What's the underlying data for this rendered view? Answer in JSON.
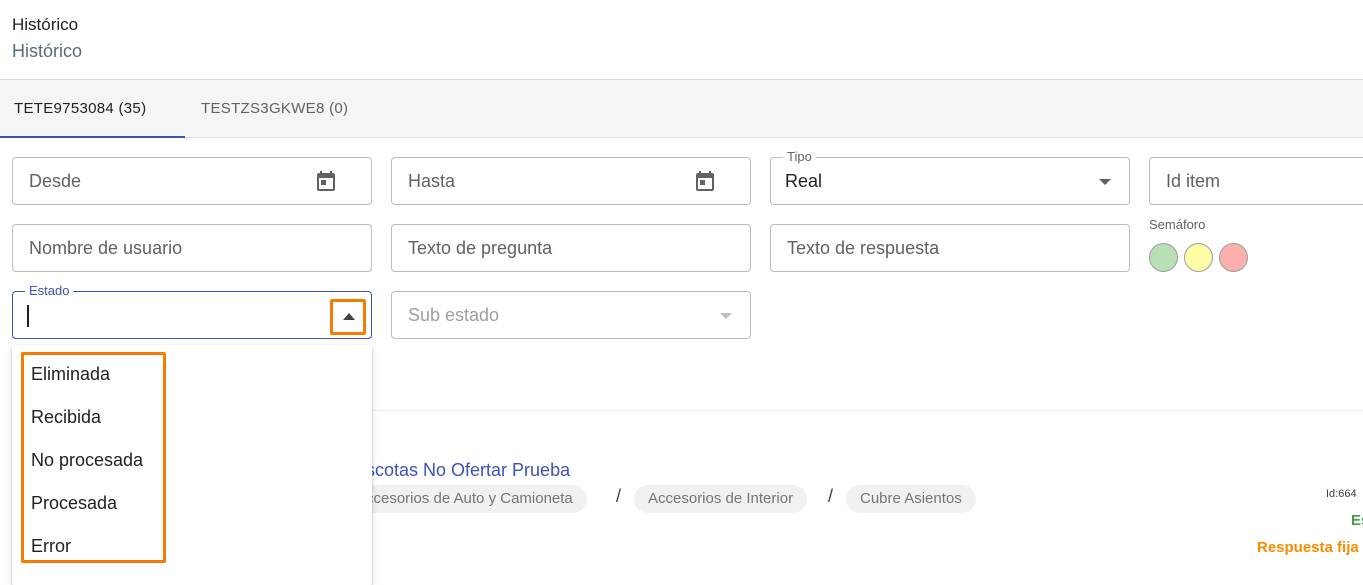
{
  "header": {
    "title": "Histórico",
    "subtitle": "Histórico"
  },
  "tabs": [
    {
      "label": "TETE9753084 (35)",
      "active": true
    },
    {
      "label": "TESTZS3GKWE8 (0)",
      "active": false
    }
  ],
  "filters": {
    "desde": {
      "placeholder": "Desde",
      "icon": "calendar-icon"
    },
    "hasta": {
      "placeholder": "Hasta",
      "icon": "calendar-icon"
    },
    "tipo": {
      "label": "Tipo",
      "value": "Real"
    },
    "id_item": {
      "placeholder": "Id item"
    },
    "nombre_usuario": {
      "placeholder": "Nombre de usuario"
    },
    "texto_pregunta": {
      "placeholder": "Texto de pregunta"
    },
    "texto_respuesta": {
      "placeholder": "Texto de respuesta"
    },
    "semaforo": {
      "label": "Semáforo",
      "colors": [
        "#b9dfb5",
        "#fdfda6",
        "#fbb0ae"
      ]
    },
    "estado": {
      "label": "Estado",
      "value": ""
    },
    "sub_estado": {
      "placeholder": "Sub estado"
    }
  },
  "estado_options": [
    "Eliminada",
    "Recibida",
    "No procesada",
    "Procesada",
    "Error"
  ],
  "result": {
    "title": "scotas No Ofertar Prueba",
    "breadcrumbs": [
      "ccesorios de Auto y Camioneta",
      "Accesorios de Interior",
      "Cubre Asientos"
    ],
    "separator": "/",
    "id_text": "Id:664",
    "status_green": "Es",
    "status_orange": "Respuesta fija"
  },
  "colors": {
    "accent": "#3f51b5",
    "highlight": "#f57c00",
    "link": "#3f51b5"
  }
}
